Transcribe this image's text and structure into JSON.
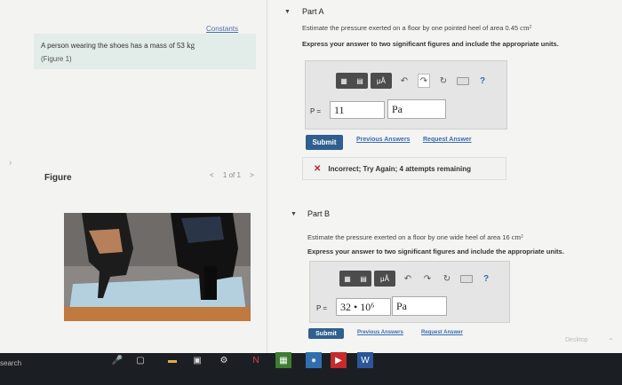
{
  "problem": {
    "constants_label": "Constants",
    "statement": "A person wearing the shoes has a mass of 53",
    "statement_unit": "kg",
    "figure_ref": "(Figure 1)"
  },
  "figure": {
    "heading": "Figure",
    "pager": "1 of 1",
    "prev": "<",
    "next": ">"
  },
  "part_a": {
    "title": "Part A",
    "question": "Estimate the pressure exerted on a floor by one pointed heel of area 0.45",
    "question_unit": "cm²",
    "instruction": "Express your answer to two significant figures and include the appropriate units.",
    "var_label": "P =",
    "value": "11",
    "units": "Pa",
    "submit": "Submit",
    "previous_answers": "Previous Answers",
    "request_answer": "Request Answer",
    "feedback_icon": "✕",
    "feedback": "Incorrect; Try Again; 4 attempts remaining"
  },
  "part_b": {
    "title": "Part B",
    "question": "Estimate the pressure exerted on a floor by one wide heel of area 16",
    "question_unit": "cm²",
    "instruction": "Express your answer to two significant figures and include the appropriate units.",
    "var_label": "P =",
    "value": "32 • 10⁶",
    "units": "Pa",
    "submit": "Submit",
    "previous_answers": "Previous Answers",
    "request_answer": "Request Answer"
  },
  "toolbar": {
    "mu_label": "μÅ",
    "help": "?"
  },
  "taskbar": {
    "search": "search",
    "desktop": "Desktop"
  }
}
